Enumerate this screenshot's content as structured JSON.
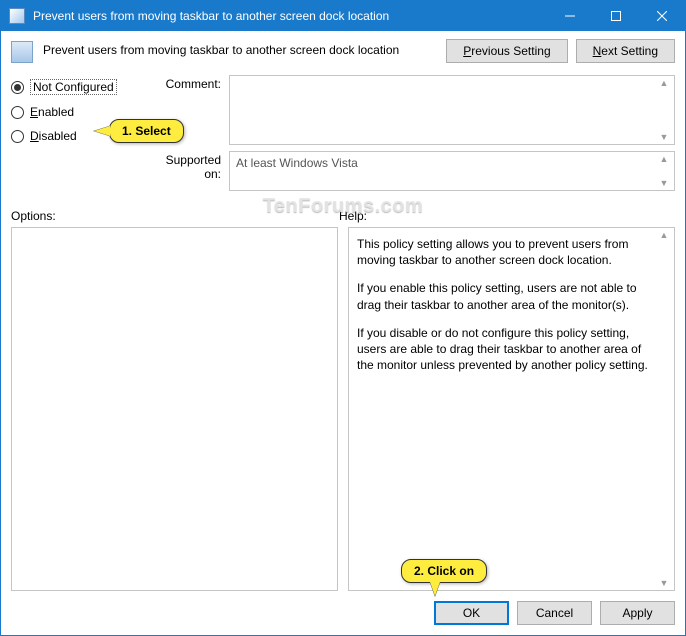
{
  "window": {
    "title": "Prevent users from moving taskbar to another screen dock location"
  },
  "dialog": {
    "title": "Prevent users from moving taskbar to another screen dock location"
  },
  "nav": {
    "prev": "Previous Setting",
    "next": "Next Setting"
  },
  "radios": {
    "not_configured": "Not Configured",
    "enabled_u": "E",
    "enabled_rest": "nabled",
    "disabled_u": "D",
    "disabled_rest": "isabled",
    "selected": "not_configured"
  },
  "fields": {
    "comment_label": "Comment:",
    "comment_value": "",
    "supported_label": "Supported on:",
    "supported_value": "At least Windows Vista"
  },
  "panels": {
    "options_label": "Options:",
    "help_label": "Help:"
  },
  "help": {
    "p1": "This policy setting allows you to prevent users from moving taskbar to another screen dock location.",
    "p2": "If you enable this policy setting, users are not able to drag their taskbar to another area of the monitor(s).",
    "p3": "If you disable or do not configure this policy setting, users are able to drag their taskbar to another area of the monitor unless prevented by another policy setting."
  },
  "footer": {
    "ok": "OK",
    "cancel": "Cancel",
    "apply": "Apply"
  },
  "callouts": {
    "c1": "1. Select",
    "c2": "2. Click on"
  },
  "watermark": "TenForums.com"
}
